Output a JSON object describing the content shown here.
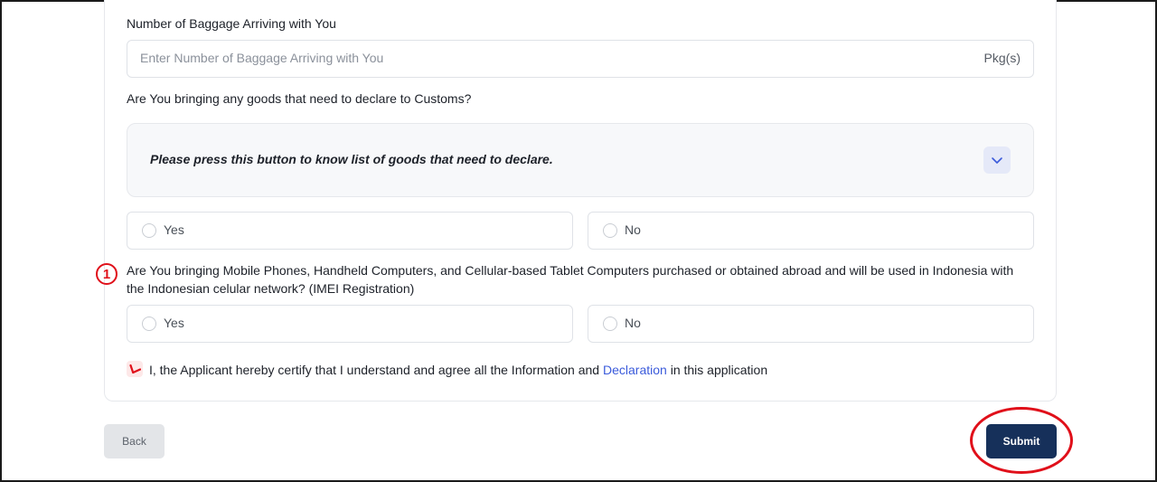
{
  "baggage": {
    "label": "Number of Baggage Arriving with You",
    "placeholder": "Enter Number of Baggage Arriving with You",
    "suffix": "Pkg(s)"
  },
  "customs": {
    "question": "Are You bringing any goods that need to declare to Customs?",
    "accordion_text": "Please press this button to know list of goods that need to declare.",
    "options": [
      "Yes",
      "No"
    ]
  },
  "imei": {
    "annotation_number": "1",
    "question_line1": "Are You bringing Mobile Phones, Handheld Computers, and Cellular-based Tablet Computers purchased or obtained abroad and will be used in Indonesia with",
    "question_line2": "the Indonesian celular network? (IMEI Registration)",
    "options": [
      "Yes",
      "No"
    ]
  },
  "certify": {
    "text_before": "I, the Applicant hereby certify that I understand and agree all the Information and ",
    "link": "Declaration",
    "text_after": " in this application"
  },
  "buttons": {
    "back": "Back",
    "submit": "Submit"
  },
  "colors": {
    "primary": "#16305a",
    "annotation": "#e0101a",
    "link": "#3b5bdb"
  }
}
